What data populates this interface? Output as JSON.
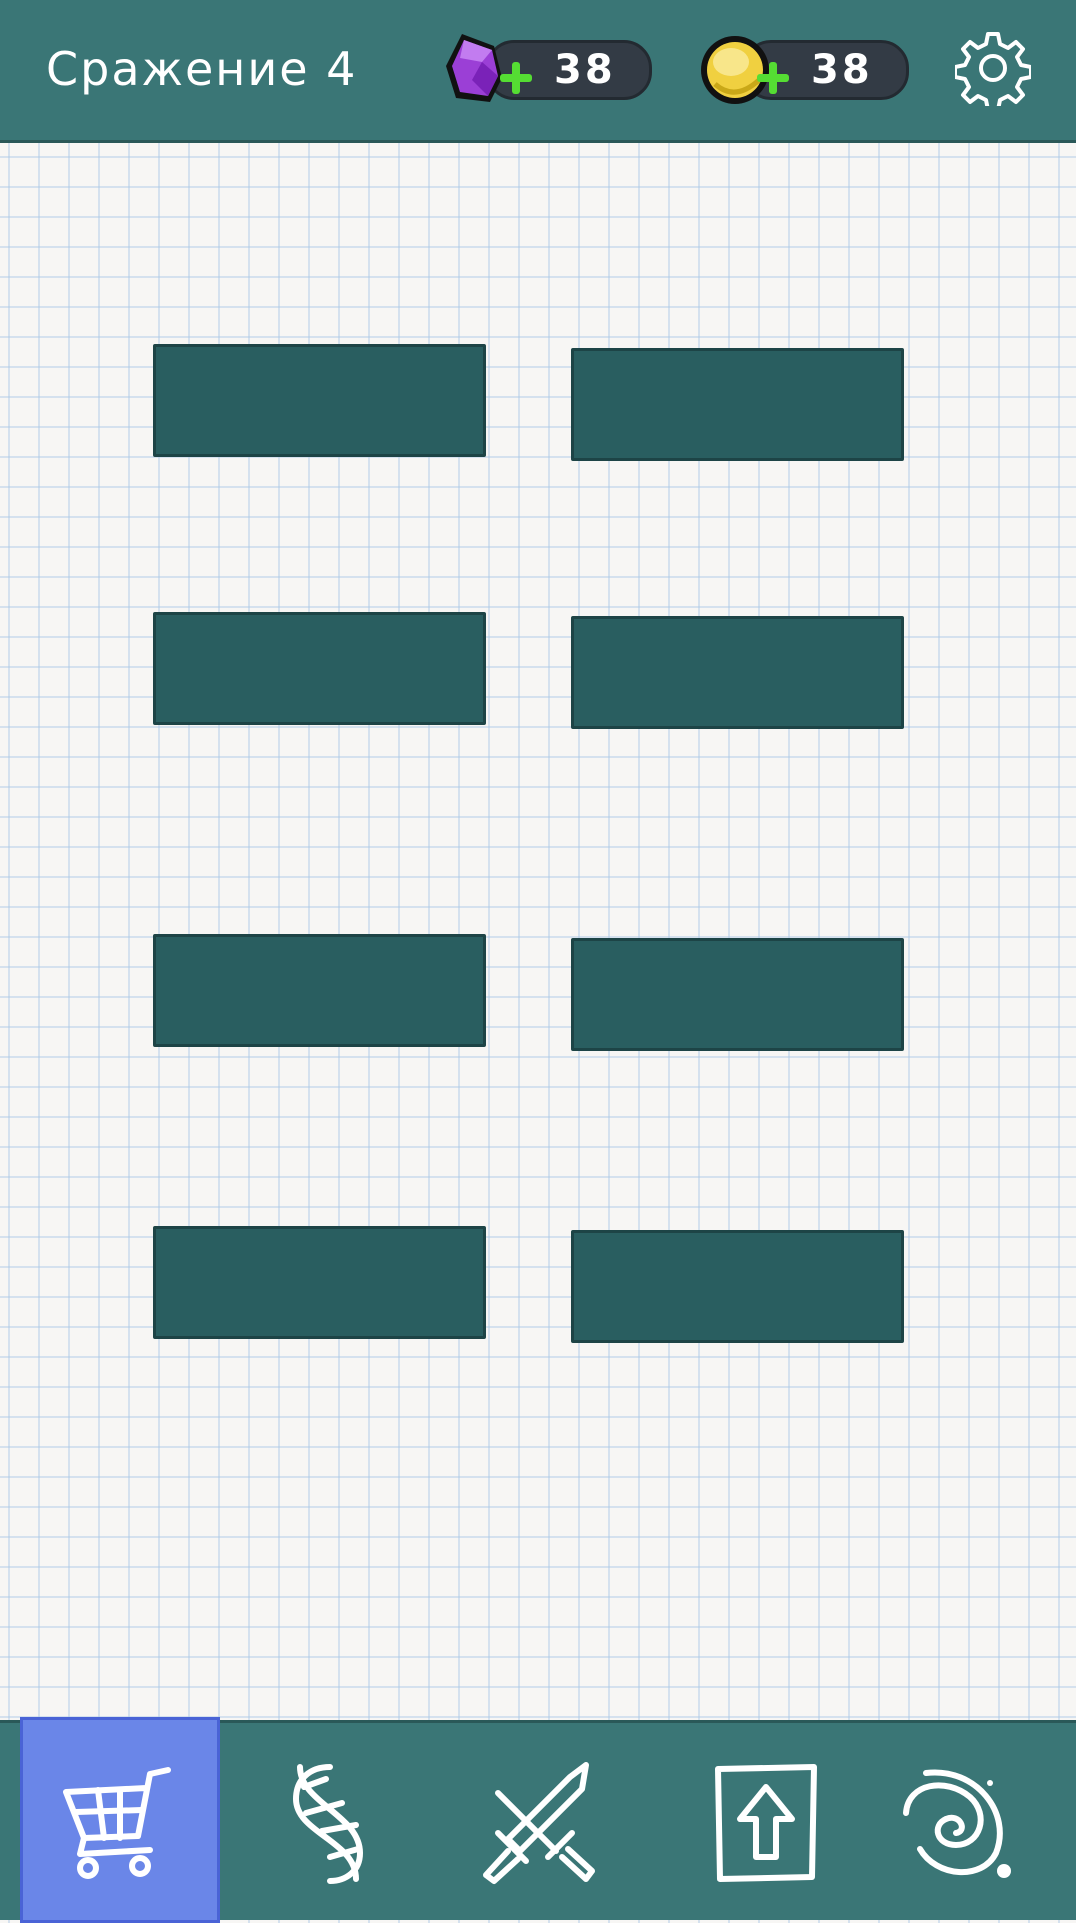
{
  "header": {
    "title": "Сражение 4",
    "gems": {
      "amount": "38",
      "icon": "purple-gem-icon"
    },
    "coins": {
      "amount": "38",
      "icon": "gold-coin-icon"
    },
    "settings_icon": "gear-icon"
  },
  "slots": {
    "count": 8,
    "color": "#295e60"
  },
  "bottom_nav": {
    "items": [
      {
        "icon": "shopping-cart-icon",
        "active": true
      },
      {
        "icon": "dna-icon",
        "active": false
      },
      {
        "icon": "crossed-swords-icon",
        "active": false
      },
      {
        "icon": "upgrade-arrow-icon",
        "active": false
      },
      {
        "icon": "galaxy-icon",
        "active": false
      }
    ]
  },
  "colors": {
    "bar": "#3a7676",
    "active_tab": "#6a86e8",
    "gem": "#9b3fd6",
    "coin": "#f0d040",
    "plus": "#55dd33"
  }
}
